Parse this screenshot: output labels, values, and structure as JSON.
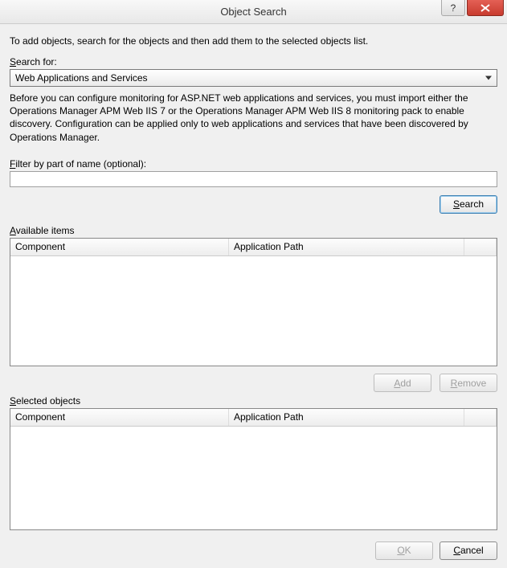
{
  "window": {
    "title": "Object Search",
    "help_symbol": "?",
    "close_label": "Close"
  },
  "instruction": "To add objects, search for the objects and then add them to the selected objects list.",
  "search_for": {
    "label_pre": "S",
    "label_rest": "earch for:",
    "selected": "Web Applications and Services"
  },
  "description": "Before you can configure monitoring for ASP.NET web applications and services, you must import either the Operations Manager APM Web IIS 7 or the Operations Manager APM Web IIS 8 monitoring pack to enable discovery. Configuration can be applied only to web applications and services that have been discovered by Operations Manager.",
  "filter": {
    "label_pre": "F",
    "label_rest": "ilter by part of name (optional):",
    "value": ""
  },
  "buttons": {
    "search_pre": "S",
    "search_rest": "earch",
    "add_pre": "A",
    "add_rest": "dd",
    "remove_pre": "R",
    "remove_rest": "emove",
    "ok_pre": "O",
    "ok_rest": "K",
    "cancel_pre": "C",
    "cancel_rest": "ancel"
  },
  "available": {
    "label_pre": "A",
    "label_rest": "vailable items",
    "columns": {
      "component": "Component",
      "apppath": "Application Path"
    },
    "rows": []
  },
  "selected": {
    "label_pre": "S",
    "label_rest": "elected objects",
    "columns": {
      "component": "Component",
      "apppath": "Application Path"
    },
    "rows": []
  }
}
